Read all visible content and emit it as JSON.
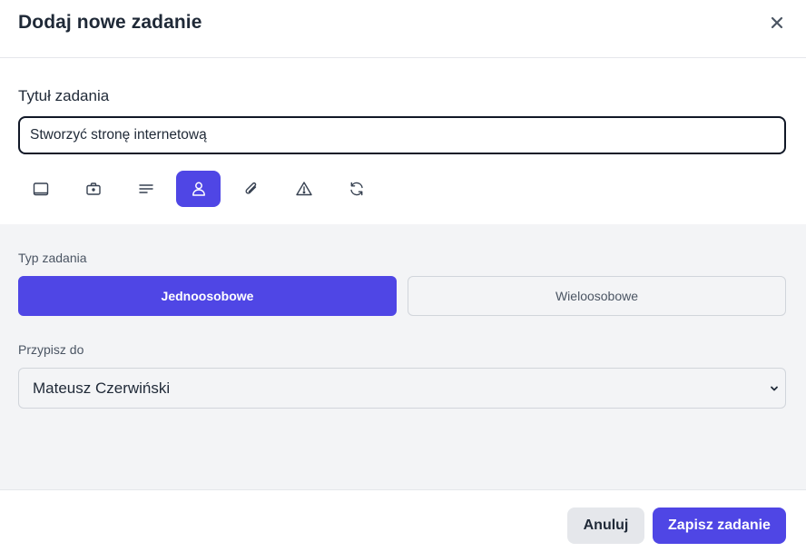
{
  "dialog": {
    "title": "Dodaj nowe zadanie"
  },
  "task": {
    "label": "Tytuł zadania",
    "value": "Stworzyć stronę internetową"
  },
  "toolbar": {
    "tools": [
      {
        "icon": "calendar-icon",
        "active": false
      },
      {
        "icon": "briefcase-icon",
        "active": false
      },
      {
        "icon": "description-lines-icon",
        "active": false
      },
      {
        "icon": "user-icon",
        "active": true
      },
      {
        "icon": "paperclip-icon",
        "active": false
      },
      {
        "icon": "warning-triangle-icon",
        "active": false
      },
      {
        "icon": "refresh-icon",
        "active": false
      }
    ]
  },
  "task_type": {
    "label": "Typ zadania",
    "options": [
      "Jednoosobowe",
      "Wieloosobowe"
    ],
    "selected": "Jednoosobowe"
  },
  "assign": {
    "label": "Przypisz do",
    "value": "Mateusz Czerwiński"
  },
  "footer": {
    "cancel_label": "Anuluj",
    "save_label": "Zapisz zadanie"
  },
  "colors": {
    "accent": "#4f46e5",
    "text": "#1f2937",
    "muted_bg": "#f3f4f6",
    "border": "#e5e7eb"
  }
}
